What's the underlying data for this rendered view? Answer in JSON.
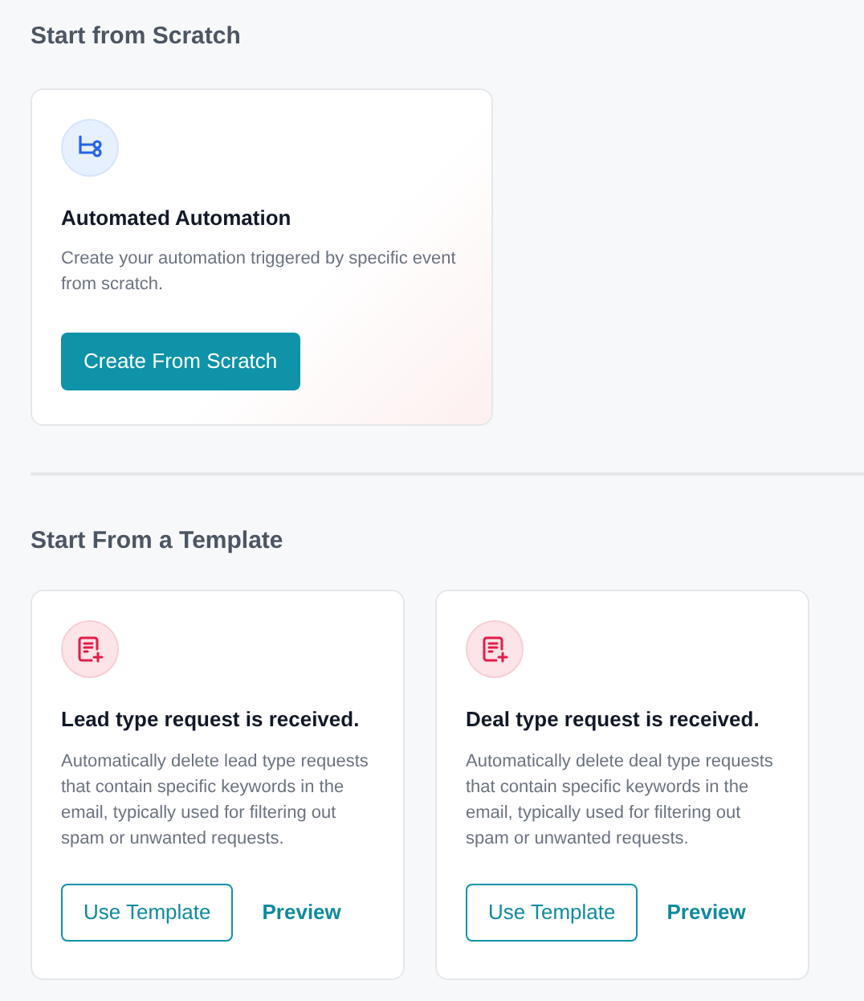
{
  "scratch_section": {
    "heading": "Start from Scratch",
    "card": {
      "title": "Automated Automation",
      "description": "Create your automation triggered by specific event from scratch.",
      "button": "Create From Scratch"
    }
  },
  "template_section": {
    "heading": "Start From a Template",
    "cards": [
      {
        "title": "Lead type request is received.",
        "description": "Automatically delete lead type requests that contain specific keywords in the email, typically used for filtering out spam or unwanted requests.",
        "primary_button": "Use Template",
        "link": "Preview"
      },
      {
        "title": "Deal type request is received.",
        "description": "Automatically delete deal type requests that contain specific keywords in the email, typically used for filtering out spam or unwanted requests.",
        "primary_button": "Use Template",
        "link": "Preview"
      }
    ]
  }
}
